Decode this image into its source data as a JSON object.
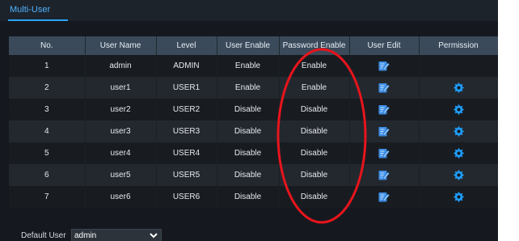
{
  "tab": {
    "label": "Multi-User"
  },
  "table": {
    "headers": [
      "No.",
      "User Name",
      "Level",
      "User Enable",
      "Password Enable",
      "User Edit",
      "Permission"
    ],
    "rows": [
      {
        "no": "1",
        "user": "admin",
        "level": "ADMIN",
        "user_enable": "Enable",
        "pwd_enable": "Enable",
        "permission": false
      },
      {
        "no": "2",
        "user": "user1",
        "level": "USER1",
        "user_enable": "Enable",
        "pwd_enable": "Enable",
        "permission": true
      },
      {
        "no": "3",
        "user": "user2",
        "level": "USER2",
        "user_enable": "Disable",
        "pwd_enable": "Disable",
        "permission": true
      },
      {
        "no": "4",
        "user": "user3",
        "level": "USER3",
        "user_enable": "Disable",
        "pwd_enable": "Disable",
        "permission": true
      },
      {
        "no": "5",
        "user": "user4",
        "level": "USER4",
        "user_enable": "Disable",
        "pwd_enable": "Disable",
        "permission": true
      },
      {
        "no": "6",
        "user": "user5",
        "level": "USER5",
        "user_enable": "Disable",
        "pwd_enable": "Disable",
        "permission": true
      },
      {
        "no": "7",
        "user": "user6",
        "level": "USER6",
        "user_enable": "Disable",
        "pwd_enable": "Disable",
        "permission": true
      }
    ]
  },
  "footer": {
    "default_user_label": "Default User",
    "default_user_value": "admin"
  },
  "icons": {
    "user_edit": "edit-pencil-icon",
    "permission": "gear-icon",
    "dropdown": "chevron-down-icon"
  },
  "colors": {
    "accent": "#2aa4ff",
    "annotation": "#e8141c"
  }
}
